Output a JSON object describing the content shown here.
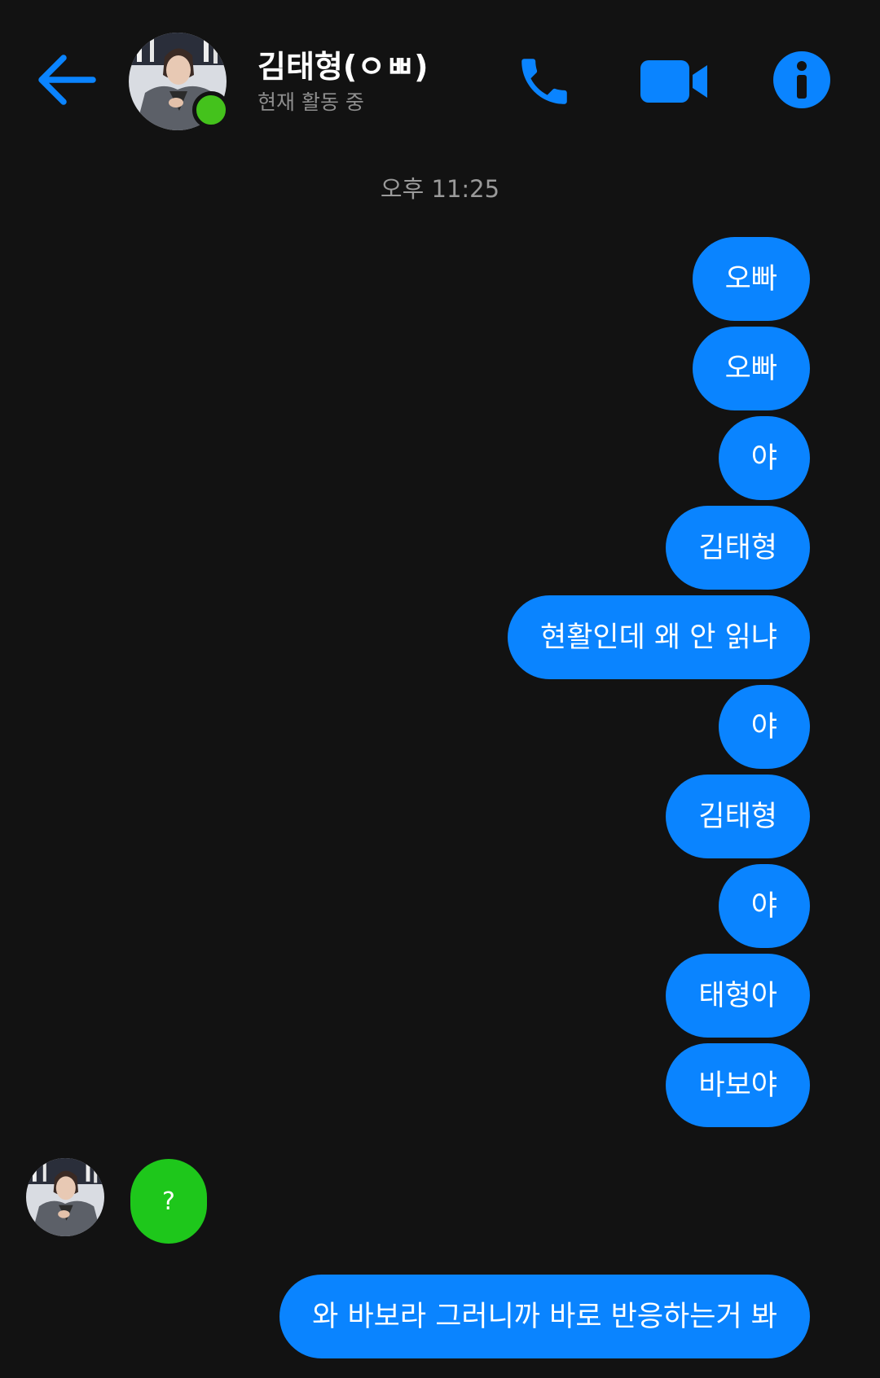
{
  "header": {
    "contact_name": "김태형(ㅇㅃ)",
    "status": "현재 활동 중",
    "back_icon": "arrow-left-icon",
    "call_icon": "phone-icon",
    "video_icon": "video-camera-icon",
    "info_icon": "info-icon"
  },
  "colors": {
    "accent": "#0a84ff",
    "background": "#121212",
    "online": "#44c21c",
    "received_bubble": "#1ec71b"
  },
  "timestamp": "오후 11:25",
  "messages": {
    "sent_1": "오빠",
    "sent_2": "오빠",
    "sent_3": "야",
    "sent_4": "김태형",
    "sent_5": "현활인데 왜 안 읽냐",
    "sent_6": "야",
    "sent_7": "김태형",
    "sent_8": "야",
    "sent_9": "태형아",
    "sent_10": "바보야",
    "received_1": "?",
    "sent_11": "와 바보라 그러니까 바로 반응하는거 봐"
  }
}
